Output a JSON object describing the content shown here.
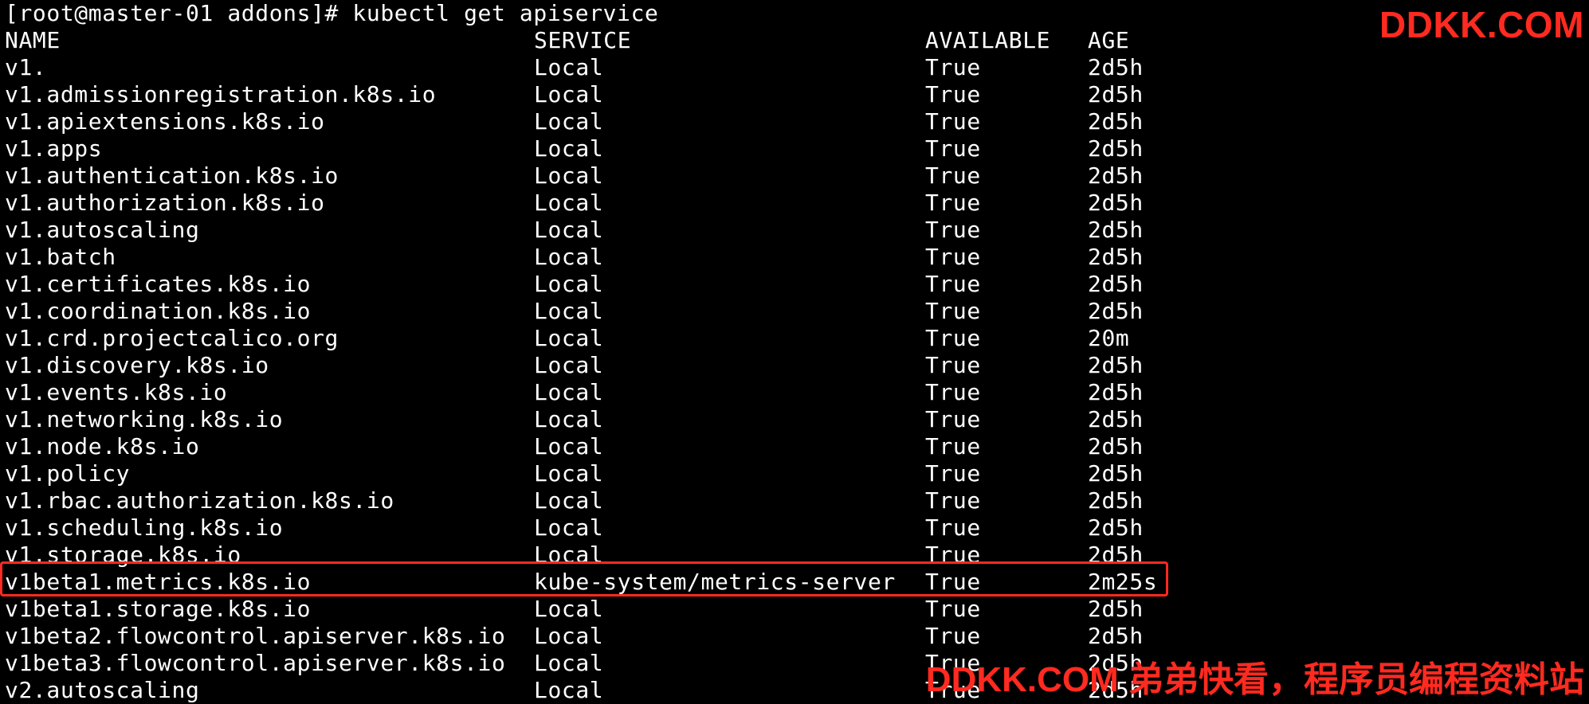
{
  "terminal": {
    "prompt": "[root@master-01 addons]# kubectl get apiservice",
    "headers": {
      "name": "NAME",
      "service": "SERVICE",
      "available": "AVAILABLE",
      "age": "AGE"
    },
    "rows": [
      {
        "name": "v1.",
        "service": "Local",
        "available": "True",
        "age": "2d5h"
      },
      {
        "name": "v1.admissionregistration.k8s.io",
        "service": "Local",
        "available": "True",
        "age": "2d5h"
      },
      {
        "name": "v1.apiextensions.k8s.io",
        "service": "Local",
        "available": "True",
        "age": "2d5h"
      },
      {
        "name": "v1.apps",
        "service": "Local",
        "available": "True",
        "age": "2d5h"
      },
      {
        "name": "v1.authentication.k8s.io",
        "service": "Local",
        "available": "True",
        "age": "2d5h"
      },
      {
        "name": "v1.authorization.k8s.io",
        "service": "Local",
        "available": "True",
        "age": "2d5h"
      },
      {
        "name": "v1.autoscaling",
        "service": "Local",
        "available": "True",
        "age": "2d5h"
      },
      {
        "name": "v1.batch",
        "service": "Local",
        "available": "True",
        "age": "2d5h"
      },
      {
        "name": "v1.certificates.k8s.io",
        "service": "Local",
        "available": "True",
        "age": "2d5h"
      },
      {
        "name": "v1.coordination.k8s.io",
        "service": "Local",
        "available": "True",
        "age": "2d5h"
      },
      {
        "name": "v1.crd.projectcalico.org",
        "service": "Local",
        "available": "True",
        "age": "20m"
      },
      {
        "name": "v1.discovery.k8s.io",
        "service": "Local",
        "available": "True",
        "age": "2d5h"
      },
      {
        "name": "v1.events.k8s.io",
        "service": "Local",
        "available": "True",
        "age": "2d5h"
      },
      {
        "name": "v1.networking.k8s.io",
        "service": "Local",
        "available": "True",
        "age": "2d5h"
      },
      {
        "name": "v1.node.k8s.io",
        "service": "Local",
        "available": "True",
        "age": "2d5h"
      },
      {
        "name": "v1.policy",
        "service": "Local",
        "available": "True",
        "age": "2d5h"
      },
      {
        "name": "v1.rbac.authorization.k8s.io",
        "service": "Local",
        "available": "True",
        "age": "2d5h"
      },
      {
        "name": "v1.scheduling.k8s.io",
        "service": "Local",
        "available": "True",
        "age": "2d5h"
      },
      {
        "name": "v1.storage.k8s.io",
        "service": "Local",
        "available": "True",
        "age": "2d5h"
      },
      {
        "name": "v1beta1.metrics.k8s.io",
        "service": "kube-system/metrics-server",
        "available": "True",
        "age": "2m25s"
      },
      {
        "name": "v1beta1.storage.k8s.io",
        "service": "Local",
        "available": "True",
        "age": "2d5h"
      },
      {
        "name": "v1beta2.flowcontrol.apiserver.k8s.io",
        "service": "Local",
        "available": "True",
        "age": "2d5h"
      },
      {
        "name": "v1beta3.flowcontrol.apiserver.k8s.io",
        "service": "Local",
        "available": "True",
        "age": "2d5h"
      },
      {
        "name": "v2.autoscaling",
        "service": "Local",
        "available": "True",
        "age": "2d5h"
      }
    ]
  },
  "watermarks": {
    "top": "DDKK.COM",
    "bottom": "DDKK.COM 弟弟快看，程序员编程资料站"
  },
  "colors": {
    "background": "#000000",
    "text": "#ffffff",
    "accent": "#ff2a20"
  }
}
